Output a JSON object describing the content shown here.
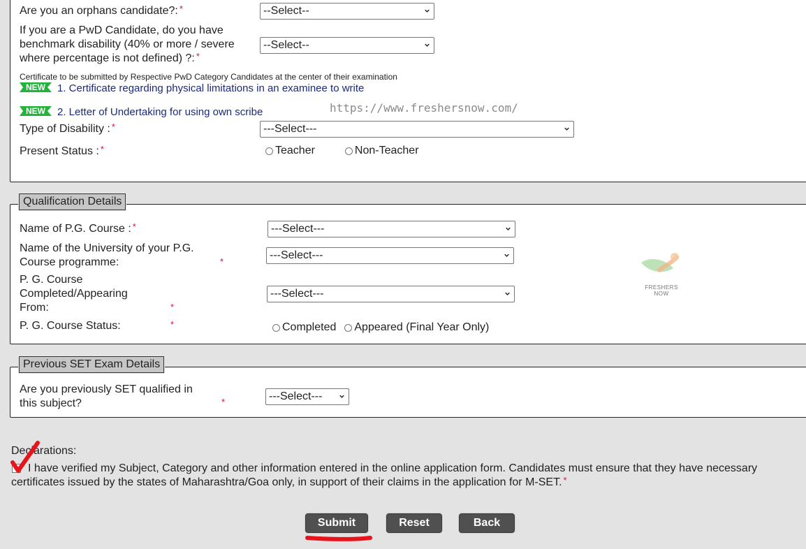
{
  "personal_section": {
    "orphan": {
      "label": "Are you an orphans candidate?:",
      "select_value": "--Select--"
    },
    "pwd": {
      "label_lines": [
        "If you are a PwD Candidate, do you have",
        "benchmark disability (40% or more / severe",
        "where percentage is not defined) ?:"
      ],
      "select_value": "--Select--"
    },
    "certificate_note": "Certificate to be submitted by Respective PwD Category Candidates at the center of their examination",
    "new_badge_text": "NEW",
    "documents": [
      {
        "label": "1. Certificate regarding physical limitations in an examinee to write"
      },
      {
        "label": "2. Letter of Undertaking for using own scribe"
      }
    ],
    "disability_type": {
      "label": "Type of Disability :",
      "select_value": "---Select---"
    },
    "present_status": {
      "label": "Present Status :",
      "options": [
        "Teacher",
        "Non-Teacher"
      ]
    }
  },
  "watermark": {
    "url": "https://www.freshersnow.com/",
    "logo_text": "FRESHERS NOW"
  },
  "qualification_section": {
    "legend": "Qualification Details",
    "pg_course": {
      "label": "Name of P.G. Course :",
      "select_value": "---Select---"
    },
    "university": {
      "label_lines": [
        "Name of the University of your P.G.",
        "Course programme:"
      ],
      "select_value": "---Select---"
    },
    "completed_from": {
      "label_lines": [
        "P. G. Course",
        "Completed/Appearing",
        "From:"
      ],
      "select_value": "---Select---"
    },
    "course_status": {
      "label": "P. G. Course Status:",
      "options": [
        "Completed",
        "Appeared (Final Year Only)"
      ]
    }
  },
  "set_section": {
    "legend": "Previous SET Exam Details",
    "qualified": {
      "label_lines": [
        "Are you previously SET qualified in",
        "this subject?"
      ],
      "select_value": "---Select---"
    }
  },
  "declarations": {
    "title": "Declarations:",
    "text_line1": "I have verified my Subject, Category and other information entered in the online application form. Candidates must ensure that they have necessary",
    "text_line2": "certificates issued by the states of Maharashtra/Goa only, in support of their claims in the application for M-SET."
  },
  "required_marker": "*",
  "buttons": {
    "submit": "Submit",
    "reset": "Reset",
    "back": "Back"
  },
  "annotation_colors": {
    "checkmark": "#e8141c",
    "underline": "#e8141c"
  }
}
